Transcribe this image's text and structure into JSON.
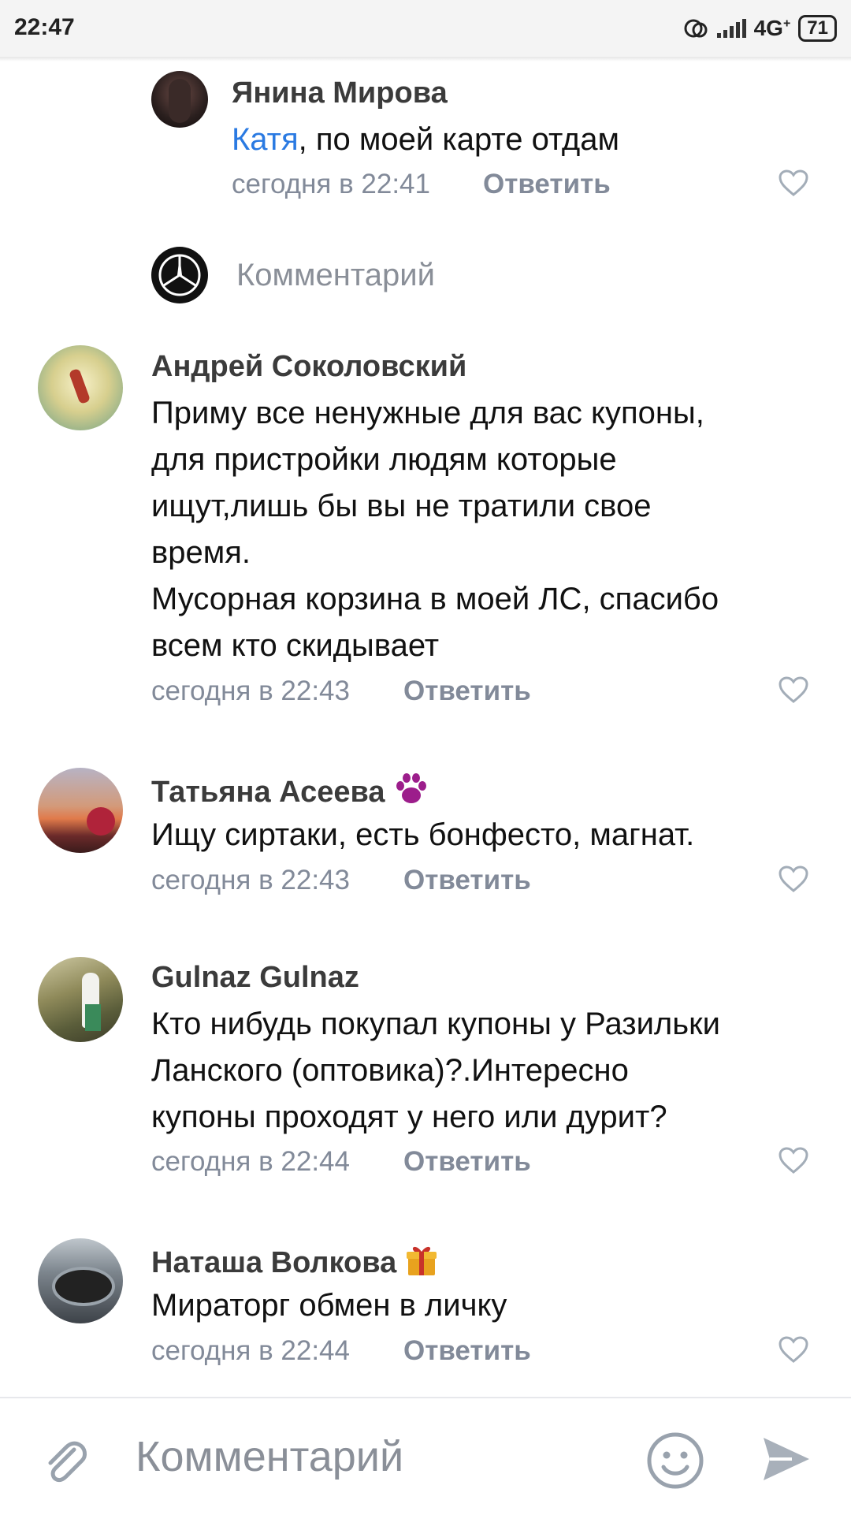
{
  "status_bar": {
    "time": "22:47",
    "network": "4G",
    "network_plus": "+",
    "battery": "71"
  },
  "reply_comment": {
    "author": "Янина Мирова",
    "mention": "Катя",
    "text_rest": ", по моей карте отдам",
    "time": "сегодня в 22:41",
    "reply_label": "Ответить"
  },
  "reply_field": {
    "placeholder": "Комментарий"
  },
  "comments": [
    {
      "author": "Андрей Соколовский",
      "lines": [
        "Приму все ненужные для вас купоны,",
        "для пристройки людям которые",
        "ищут,лишь бы вы не тратили свое",
        "время.",
        "Мусорная корзина в моей ЛС, спасибо",
        "всем кто скидывает"
      ],
      "time": "сегодня в 22:43",
      "reply_label": "Ответить"
    },
    {
      "author": "Татьяна Асеева",
      "lines": [
        "Ищу сиртаки, есть  бонфесто, магнат."
      ],
      "time": "сегодня в 22:43",
      "reply_label": "Ответить"
    },
    {
      "author": "Gulnaz Gulnaz",
      "lines": [
        "Кто нибудь покупал купоны у Разильки",
        "Ланского (оптовика)?.Интересно",
        "купоны проходят у него или дурит?"
      ],
      "time": "сегодня в 22:44",
      "reply_label": "Ответить"
    },
    {
      "author": "Наташа Волкова",
      "lines": [
        "Мираторг обмен в личку"
      ],
      "time": "сегодня в 22:44",
      "reply_label": "Ответить"
    }
  ],
  "bottom_bar": {
    "placeholder": "Комментарий"
  },
  "colors": {
    "link": "#2a7ae2",
    "meta": "#828a99",
    "text": "#111111"
  }
}
